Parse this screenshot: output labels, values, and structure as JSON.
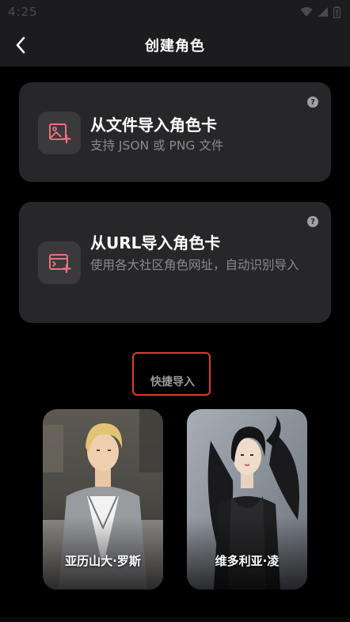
{
  "status_bar": {
    "time": "4:25",
    "icons": [
      "wifi-icon",
      "signal-icon",
      "battery-icon"
    ]
  },
  "header": {
    "title": "创建角色",
    "back_icon": "chevron-left-icon"
  },
  "import_file": {
    "title": "从文件导入角色卡",
    "description": "支持 JSON 或 PNG 文件",
    "icon": "image-add-icon",
    "help": "?"
  },
  "import_url": {
    "title": "从URL导入角色卡",
    "description": "使用各大社区角色网址，自动识别导入",
    "icon": "browser-add-icon",
    "help": "?"
  },
  "quick_import": {
    "label": "快捷导入",
    "characters": [
      {
        "name": "亚历山大·罗斯"
      },
      {
        "name": "维多利亚·凌"
      }
    ]
  },
  "colors": {
    "background": "#000000",
    "card": "#272729",
    "accent": "#e8707e",
    "highlight_border": "#e0392e",
    "muted_text": "#8a8a8e"
  }
}
